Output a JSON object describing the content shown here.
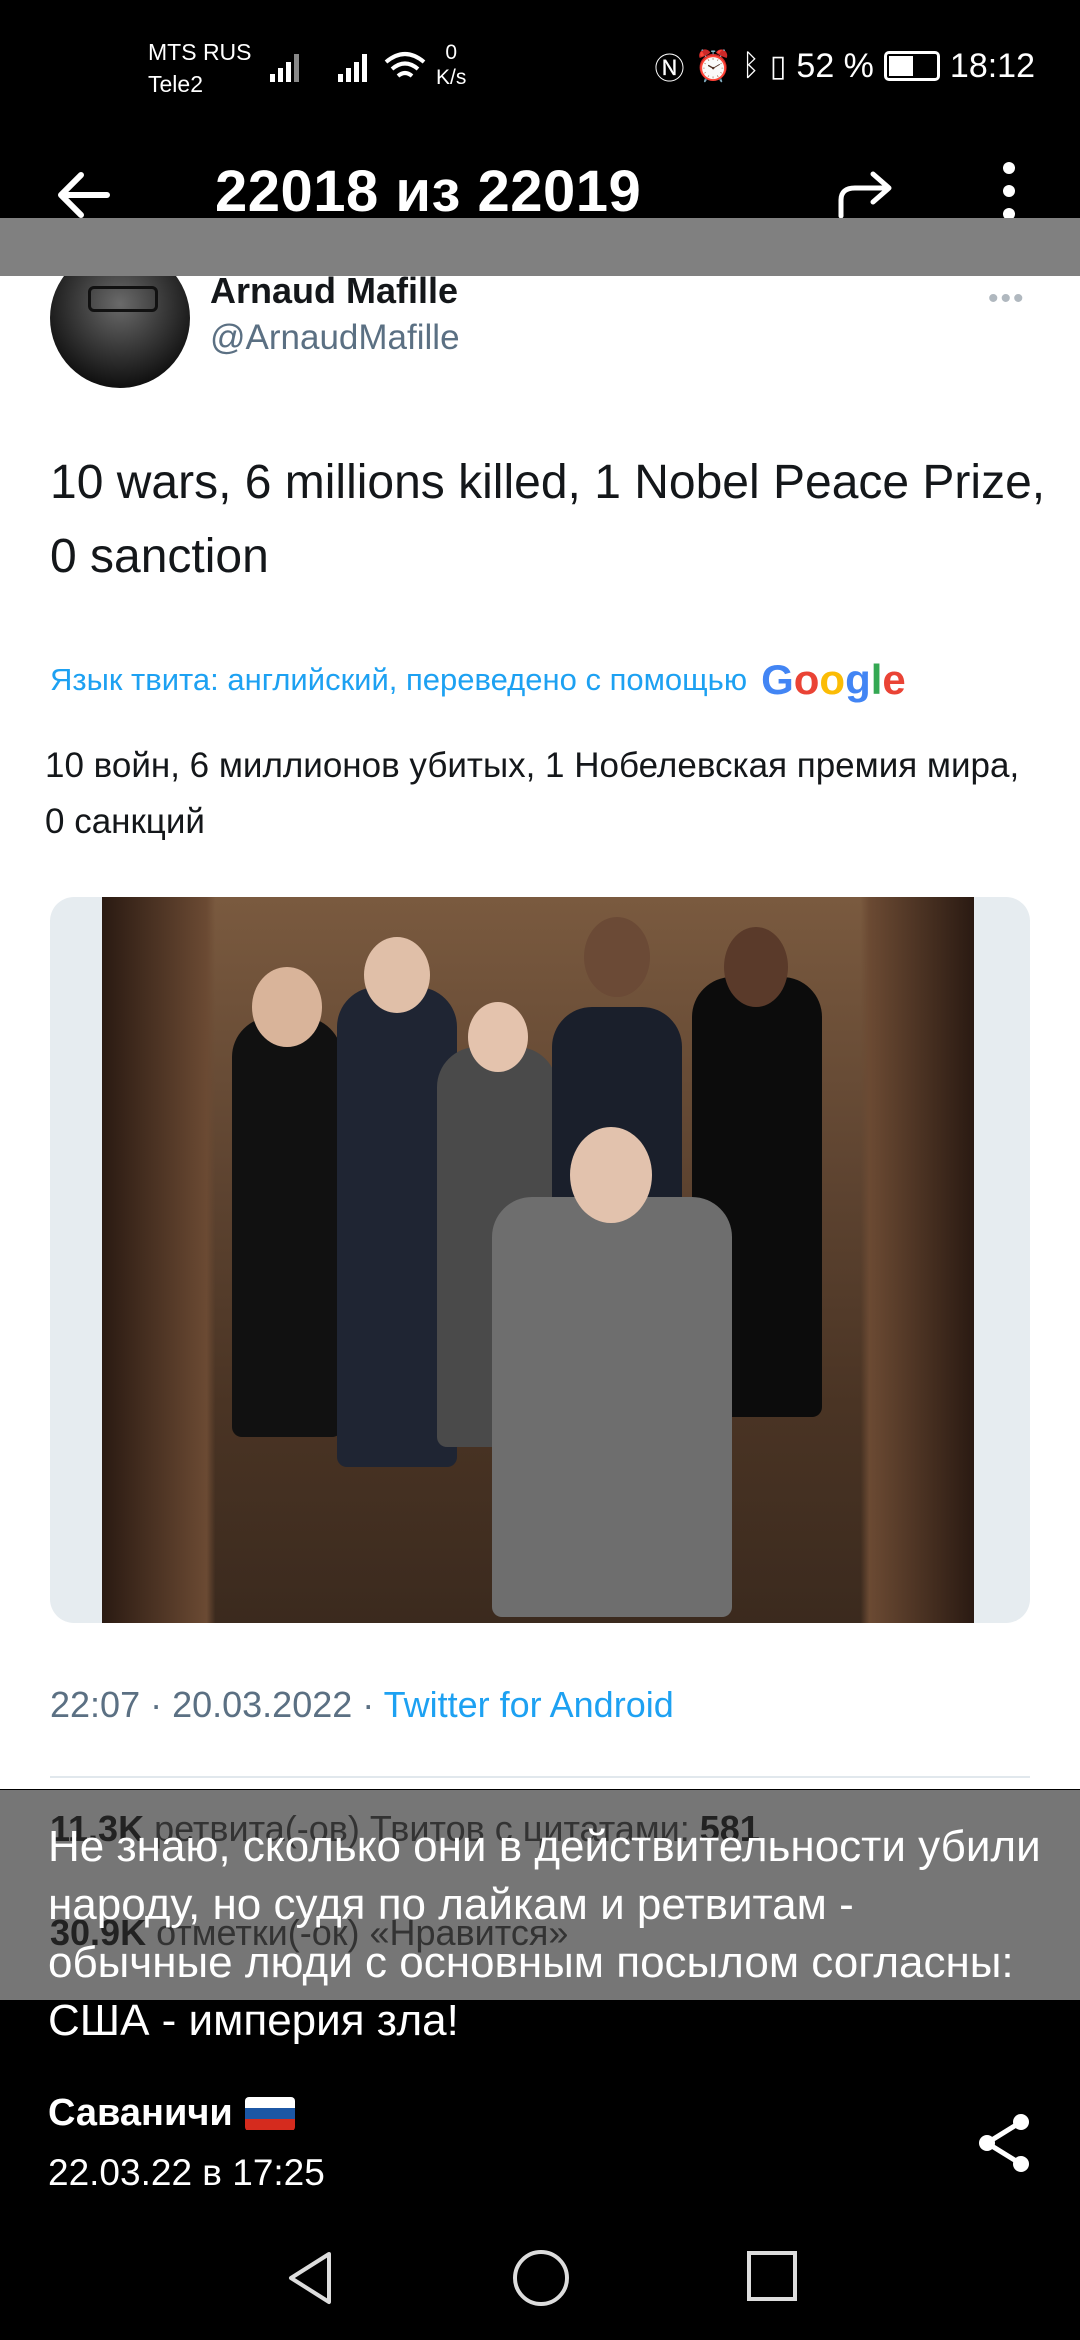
{
  "status_bar": {
    "carrier1": "MTS RUS",
    "carrier2": "Tele2",
    "net_speed_value": "0",
    "net_speed_unit": "K/s",
    "battery": "52 %",
    "time": "18:12"
  },
  "app_bar": {
    "title": "22018 из 22019"
  },
  "tweet": {
    "name": "Arnaud Mafille",
    "handle": "@ArnaudMafille",
    "text": "10 wars, 6 millions killed, 1 Nobel Peace Prize, 0 sanction",
    "translate_label": "Язык твита: английский, переведено с помощью",
    "translate_brand": [
      "G",
      "o",
      "o",
      "g",
      "l",
      "e"
    ],
    "translation": "10 войн, 6 миллионов убитых, 1 Нобелевская премия мира, 0 санкций",
    "time": "22:07 · 20.03.2022 · ",
    "source": "Twitter for Android",
    "retweets_count": "11.3K",
    "retweets_label": " ретвита(-ов)  Твитов с цитатами: ",
    "quotes_count": "581",
    "likes_count": "30.9K",
    "likes_label": " отметки(-ок) «Нравится»"
  },
  "caption": {
    "text": "Не знаю, сколько они в действительности убили народу, но судя по лайкам и ретвитам - обычные люди с основным посылом согласны: США - империя зла!",
    "author": "Саваничи",
    "date": "22.03.22 в 17:25"
  },
  "colors": {
    "twitter_blue": "#1da1f2",
    "overlay_gray": "#808080"
  }
}
